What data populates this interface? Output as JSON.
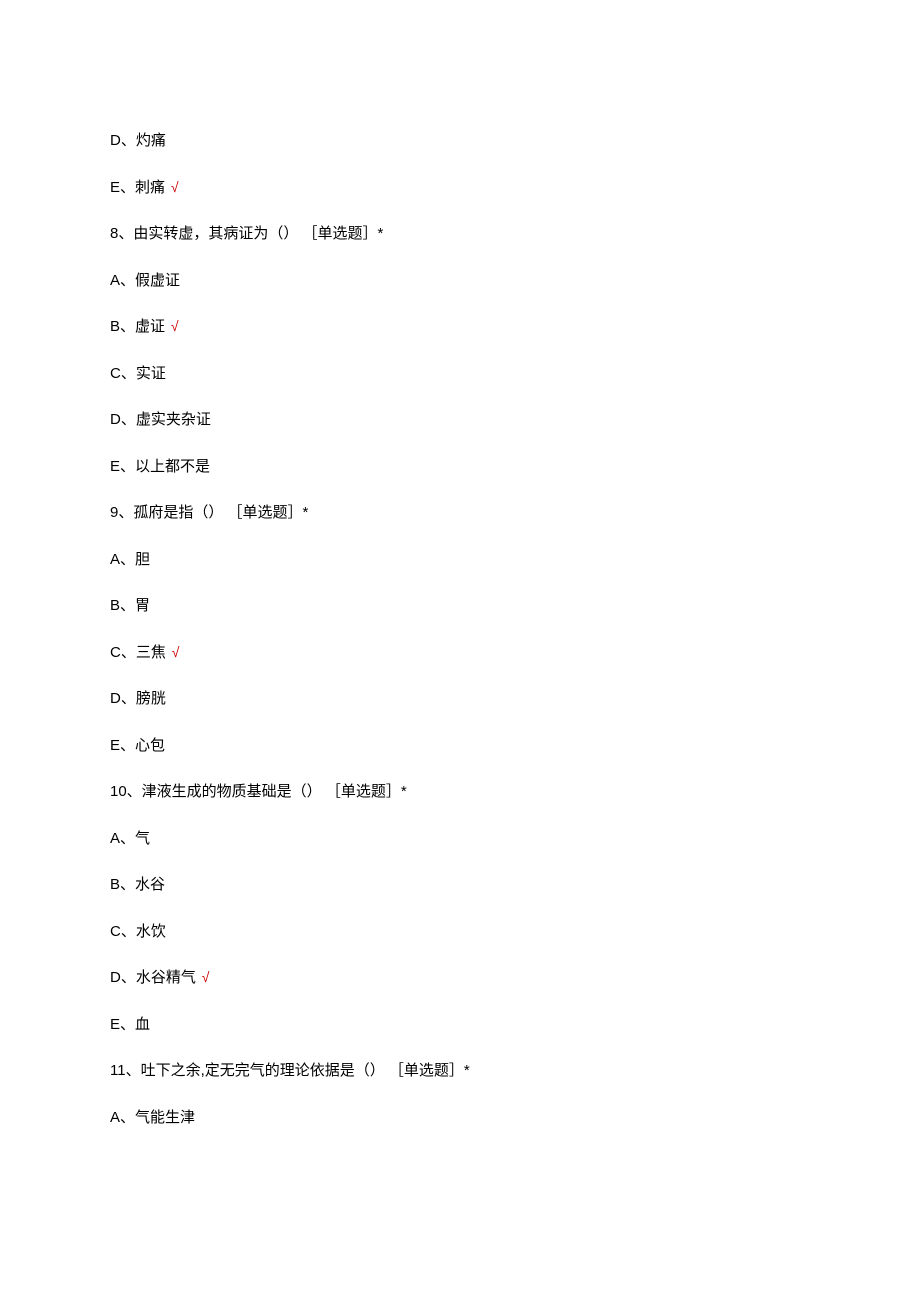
{
  "lines": [
    {
      "text": "D、灼痛",
      "correct": false
    },
    {
      "text": "E、刺痛",
      "correct": true
    },
    {
      "text": "8、由实转虚，其病证为（） ［单选题］*",
      "correct": false
    },
    {
      "text": "A、假虚证",
      "correct": false
    },
    {
      "text": "B、虚证",
      "correct": true
    },
    {
      "text": "C、实证",
      "correct": false
    },
    {
      "text": "D、虚实夹杂证",
      "correct": false
    },
    {
      "text": "E、以上都不是",
      "correct": false
    },
    {
      "text": "9、孤府是指（） ［单选题］*",
      "correct": false
    },
    {
      "text": "A、胆",
      "correct": false
    },
    {
      "text": "B、胃",
      "correct": false
    },
    {
      "text": "C、三焦",
      "correct": true
    },
    {
      "text": "D、膀胱",
      "correct": false
    },
    {
      "text": "E、心包",
      "correct": false
    },
    {
      "text": "10、津液生成的物质基础是（） ［单选题］*",
      "correct": false
    },
    {
      "text": "A、气",
      "correct": false
    },
    {
      "text": "B、水谷",
      "correct": false
    },
    {
      "text": "C、水饮",
      "correct": false
    },
    {
      "text": "D、水谷精气",
      "correct": true
    },
    {
      "text": "E、血",
      "correct": false
    },
    {
      "text": "11、吐下之余,定无完气的理论依据是（） ［单选题］*",
      "correct": false
    },
    {
      "text": "A、气能生津",
      "correct": false
    }
  ],
  "checkmark": "√"
}
